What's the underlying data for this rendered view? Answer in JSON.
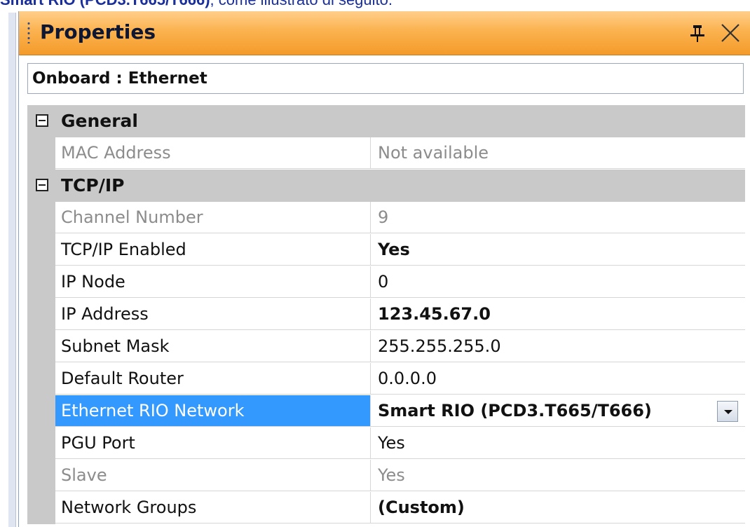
{
  "caption": {
    "bold": "Smart RIO (PCD3.T665/T666)",
    "rest": ", come illustrato di seguito."
  },
  "window": {
    "title": "Properties",
    "pin_icon": "pin-icon",
    "close_icon": "close-icon",
    "accent_color": "#f7a53b"
  },
  "object_selector": {
    "value": "Onboard : Ethernet"
  },
  "categories": [
    {
      "label": "General",
      "expanded": true,
      "properties": [
        {
          "name": "MAC Address",
          "value": "Not available",
          "enabled": false,
          "bold": false
        }
      ]
    },
    {
      "label": "TCP/IP",
      "expanded": true,
      "properties": [
        {
          "name": "Channel Number",
          "value": "9",
          "enabled": false,
          "bold": false
        },
        {
          "name": "TCP/IP Enabled",
          "value": "Yes",
          "enabled": true,
          "bold": true
        },
        {
          "name": "IP Node",
          "value": "0",
          "enabled": true,
          "bold": false
        },
        {
          "name": "IP Address",
          "value": "123.45.67.0",
          "enabled": true,
          "bold": true
        },
        {
          "name": "Subnet Mask",
          "value": "255.255.255.0",
          "enabled": true,
          "bold": false
        },
        {
          "name": "Default Router",
          "value": "0.0.0.0",
          "enabled": true,
          "bold": false
        },
        {
          "name": "Ethernet RIO Network",
          "value": "Smart RIO (PCD3.T665/T666)",
          "enabled": true,
          "bold": true,
          "selected": true,
          "has_dropdown": true
        },
        {
          "name": "PGU Port",
          "value": "Yes",
          "enabled": true,
          "bold": false
        },
        {
          "name": "Slave",
          "value": "Yes",
          "enabled": false,
          "bold": false
        },
        {
          "name": "Network Groups",
          "value": "(Custom)",
          "enabled": true,
          "bold": true
        }
      ]
    }
  ],
  "colors": {
    "selected_row": "#3399ff",
    "category_band": "#c9c9c9",
    "disabled_text": "#8c8c8c"
  }
}
